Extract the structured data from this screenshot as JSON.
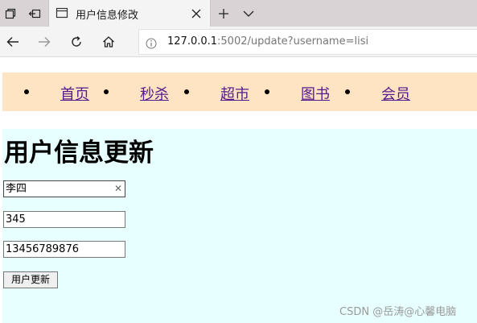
{
  "browser": {
    "tab": {
      "title": "用户信息修改"
    },
    "address": {
      "host": "127.0.0.1",
      "rest": ":5002/update?username=lisi"
    }
  },
  "menu": {
    "items": [
      {
        "label": "首页"
      },
      {
        "label": "秒杀"
      },
      {
        "label": "超市"
      },
      {
        "label": "图书"
      },
      {
        "label": "会员"
      }
    ]
  },
  "form": {
    "title": "用户信息更新",
    "name_value": "李四",
    "password_value": "345",
    "phone_value": "13456789876",
    "submit_label": "用户更新"
  },
  "watermark": "CSDN @岳涛@心馨电脑",
  "colors": {
    "menu_bg": "#ffe4c4",
    "content_bg": "#e8ffff",
    "link": "#551a8b"
  },
  "icons": {
    "tab_actions": "tab-actions-icon",
    "set_aside_tabs": "set-aside-tabs-icon",
    "tab_page": "page-icon",
    "close": "close-icon",
    "new_tab": "plus-icon",
    "tab_list": "chevron-down-icon",
    "back": "back-arrow-icon",
    "forward": "forward-arrow-icon",
    "refresh": "refresh-icon",
    "home": "home-icon",
    "site_info": "info-icon",
    "clear_field": "clear-icon"
  }
}
